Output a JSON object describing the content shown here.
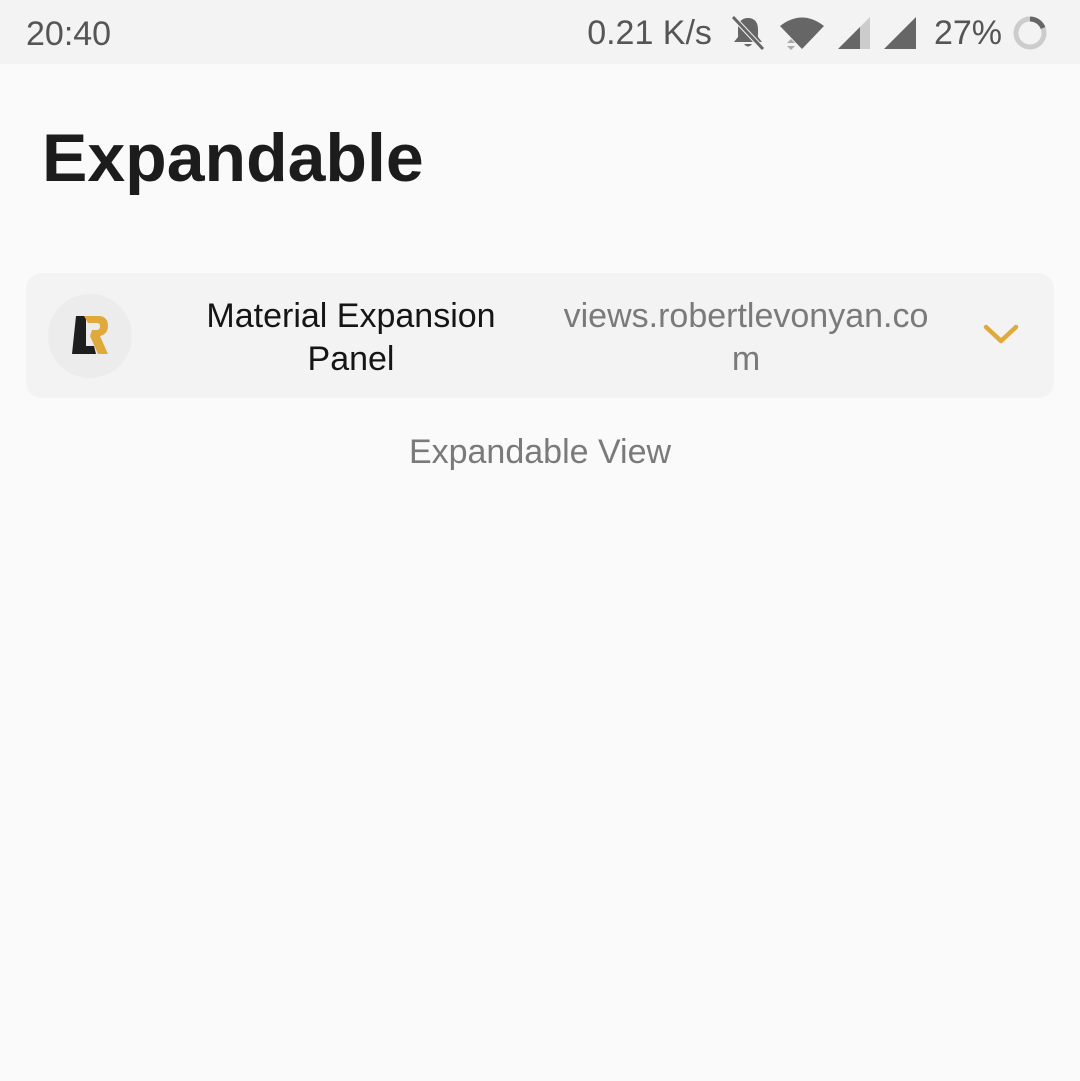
{
  "status_bar": {
    "time": "20:40",
    "network_speed": "0.21 K/s",
    "battery_percent": "27%",
    "icons": [
      "notifications-off-icon",
      "wifi-icon",
      "signal-icon",
      "signal-icon",
      "battery-icon"
    ]
  },
  "page": {
    "title": "Expandable"
  },
  "panel": {
    "logo_icon": "lr-logo-icon",
    "title": "Material Expansion Panel",
    "subtitle": "views.robertlevonyan.com",
    "expand_icon": "chevron-down-icon"
  },
  "content": {
    "label": "Expandable View"
  },
  "colors": {
    "accent": "#e0a93b",
    "logo_dark": "#1e1e1e",
    "background": "#fafafa",
    "panel_background": "#f3f3f3"
  }
}
